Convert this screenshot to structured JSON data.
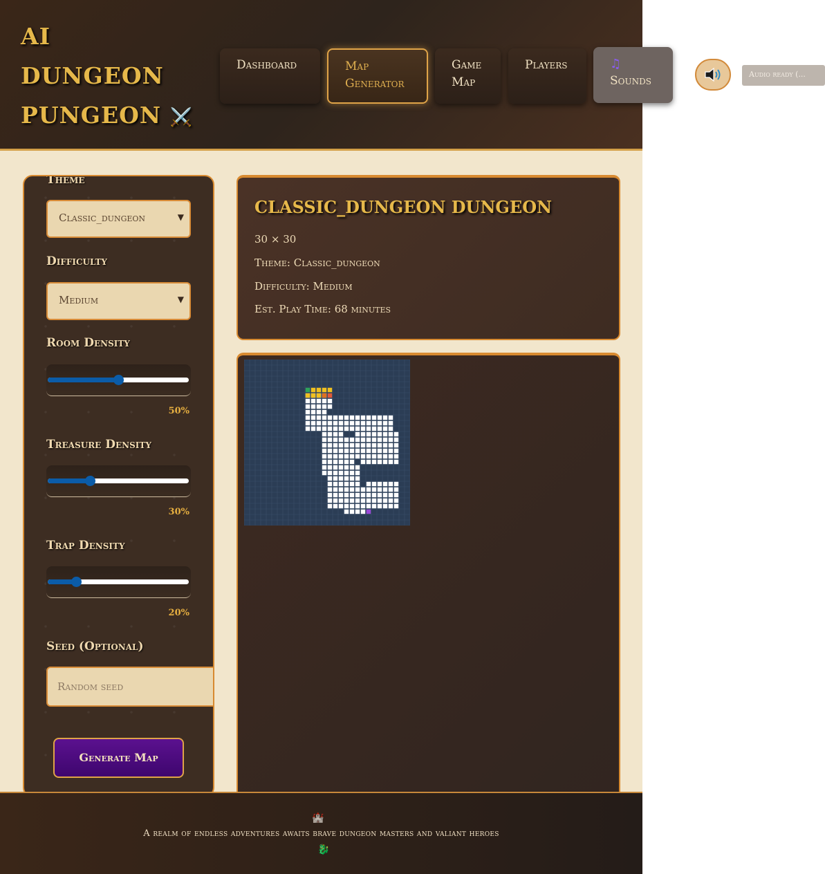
{
  "app": {
    "title_line1": "AI",
    "title_line2": "DUNGEON",
    "title_line3": "PUNGEON",
    "title_icon": "⚔️"
  },
  "nav": {
    "dashboard": "Dashboard",
    "map_gen_1": "Map",
    "map_gen_2": "Generator",
    "game_map_1": "Game",
    "game_map_2": "Map",
    "players": "Players",
    "sounds_icon": "♫",
    "sounds": "Sounds"
  },
  "audio": {
    "status": "Audio ready (..."
  },
  "sidebar": {
    "theme_label": "Theme",
    "theme_value": "Classic_dungeon",
    "difficulty_label": "Difficulty",
    "difficulty_value": "Medium",
    "room_density_label": "Room Density",
    "room_density": 50,
    "room_density_text": "50%",
    "treasure_density_label": "Treasure Density",
    "treasure_density": 30,
    "treasure_density_text": "30%",
    "trap_density_label": "Trap Density",
    "trap_density": 20,
    "trap_density_text": "20%",
    "seed_label": "Seed (Optional)",
    "seed_placeholder": "Random seed",
    "generate_button": "Generate Map"
  },
  "map_info": {
    "title": "CLASSIC_DUNGEON DUNGEON",
    "size": "30 × 30",
    "theme": "Theme: Classic_dungeon",
    "difficulty": "Difficulty: Medium",
    "play_time": "Est. Play Time: 68 minutes"
  },
  "footer": {
    "icon_top": "🏰",
    "tagline": "A realm of endless adventures awaits brave dungeon masters and valiant heroes",
    "icon_bottom": "🐉"
  },
  "colors": {
    "accent": "#e6b84a",
    "border": "#d88a30",
    "button_purple": "#5b118f",
    "map_background": "#2b3d55",
    "floor": "#ffffff"
  }
}
